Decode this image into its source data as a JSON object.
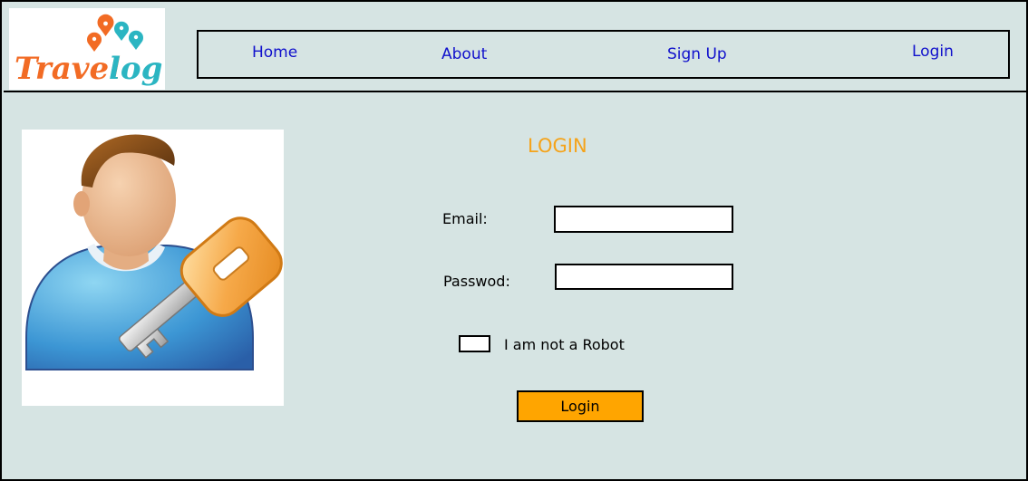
{
  "brand": {
    "logo_text": "Travellog",
    "colors": {
      "orange": "#f26b24",
      "teal": "#2bb5c2"
    }
  },
  "nav": {
    "items": [
      {
        "label": "Home"
      },
      {
        "label": "About"
      },
      {
        "label": "Sign Up"
      },
      {
        "label": "Login"
      }
    ]
  },
  "login": {
    "title": "LOGIN",
    "email_label": "Email:",
    "email_value": "",
    "password_label": "Passwod:",
    "password_value": "",
    "robot_label": "I am not a Robot",
    "robot_checked": false,
    "button_label": "Login"
  },
  "hero": {
    "icon": "user-key-icon"
  },
  "colors": {
    "background": "#d6e4e3",
    "title": "#f5a31a",
    "button": "#ffa500",
    "nav_link": "#1010cc"
  }
}
